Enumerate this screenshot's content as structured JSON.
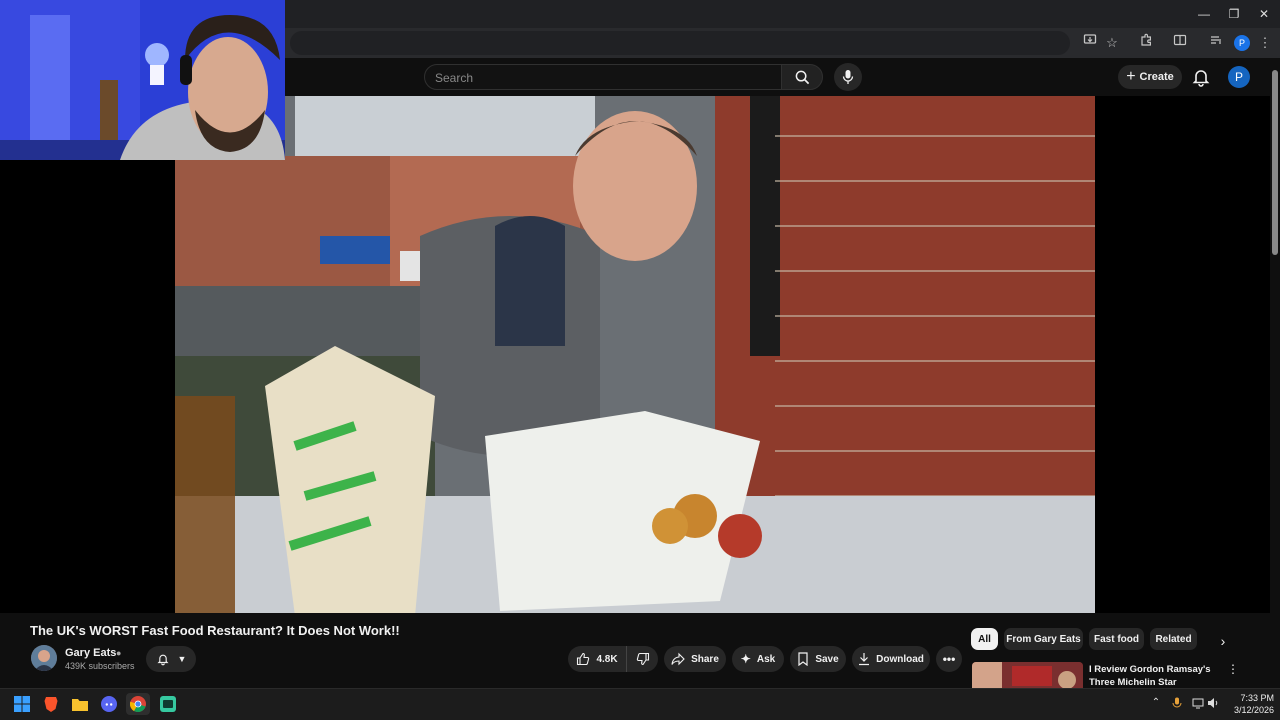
{
  "browser": {
    "window_controls": [
      "—",
      "❐",
      "✕"
    ]
  },
  "youtube": {
    "search": {
      "placeholder": "Search"
    },
    "create_label": "Create",
    "avatar_letter": "P"
  },
  "video": {
    "title": "The UK's WORST Fast Food Restaurant? It Does Not Work!!",
    "channel_name": "Gary Eats",
    "subscribers": "439K subscribers",
    "likes": "4.8K",
    "share_label": "Share",
    "ask_label": "Ask",
    "save_label": "Save",
    "download_label": "Download"
  },
  "chips": [
    "All",
    "From Gary Eats",
    "Fast food",
    "Related"
  ],
  "recommendation": {
    "title": "I Review Gordon Ramsay's Three Michelin Star Restauran..."
  },
  "taskbar": {
    "time": "7:33 PM",
    "date": "3/12/2026"
  },
  "colors": {
    "background": "#0f0f0f",
    "accent_blue": "#1565c0",
    "brick": "#8e3b2c"
  }
}
